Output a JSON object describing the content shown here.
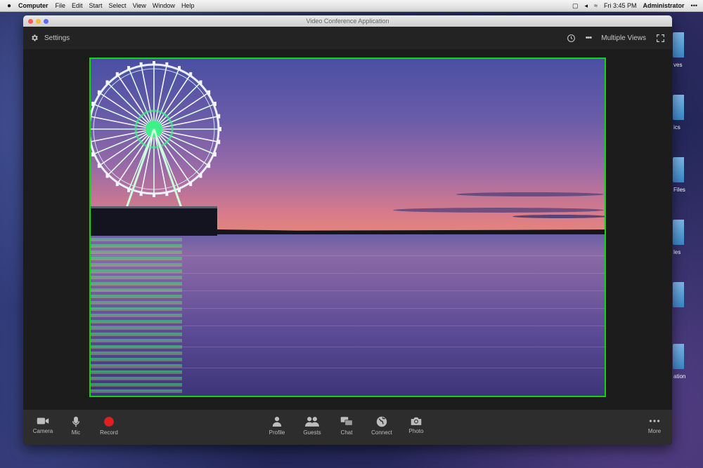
{
  "menubar": {
    "app_name": "Computer",
    "menus": [
      "File",
      "Edit",
      "Start",
      "Select",
      "View",
      "Window",
      "Help"
    ],
    "clock": "Fri 3:45 PM",
    "user": "Administrator",
    "more": "•••"
  },
  "desktop": {
    "icon_labels": [
      "ves",
      "ics",
      "Files",
      "les",
      "",
      "ation"
    ]
  },
  "window": {
    "title": "Video Conference Application",
    "toolbar": {
      "settings_label": "Settings",
      "more": "•••",
      "view_label": "Multiple Views"
    },
    "video": {
      "border_color": "#11d311"
    },
    "controls": {
      "left": [
        {
          "id": "camera",
          "label": "Camera",
          "icon": "camera-icon"
        },
        {
          "id": "mic",
          "label": "Mic",
          "icon": "mic-icon"
        },
        {
          "id": "record",
          "label": "Record",
          "icon": "record-icon"
        }
      ],
      "center": [
        {
          "id": "profile",
          "label": "Profile",
          "icon": "profile-icon"
        },
        {
          "id": "guests",
          "label": "Guests",
          "icon": "guests-icon"
        },
        {
          "id": "chat",
          "label": "Chat",
          "icon": "chat-icon"
        },
        {
          "id": "connect",
          "label": "Connect",
          "icon": "globe-icon"
        },
        {
          "id": "photo",
          "label": "Photo",
          "icon": "photo-camera-icon"
        }
      ],
      "right": [
        {
          "id": "more",
          "label": "More",
          "icon": "more-icon"
        }
      ]
    },
    "colors": {
      "record": "#e02020",
      "accent_border": "#11d311"
    }
  }
}
